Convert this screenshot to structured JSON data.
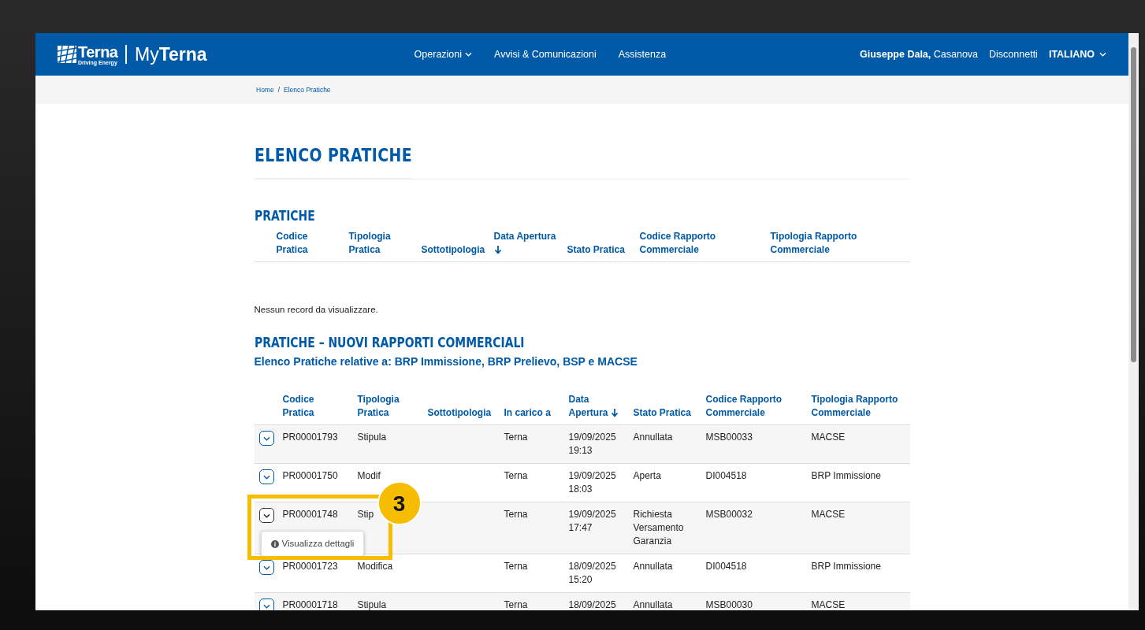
{
  "header": {
    "logo": {
      "brand": "Terna",
      "tagline": "Driving Energy",
      "app_prefix": "My",
      "app_name": "Terna"
    },
    "nav": [
      {
        "label": "Operazioni",
        "dropdown": true
      },
      {
        "label": "Avvisi & Comunicazioni",
        "dropdown": false
      },
      {
        "label": "Assistenza",
        "dropdown": false
      }
    ],
    "user": {
      "name": "Giuseppe Dala,",
      "place": "Casanova"
    },
    "logout": "Disconnetti",
    "language": {
      "label": "ITALIANO",
      "dropdown": true
    }
  },
  "breadcrumb": {
    "items": [
      "Home",
      "Elenco Pratiche"
    ],
    "separator": "/"
  },
  "page_title": "ELENCO PRATICHE",
  "pratiche": {
    "title": "PRATICHE",
    "columns": [
      {
        "label": "Codice\nPratica",
        "sorted": false
      },
      {
        "label": "Tipologia\nPratica",
        "sorted": false
      },
      {
        "label": "Sottotipologia",
        "sorted": false
      },
      {
        "label": "Data Apertura",
        "sorted": true
      },
      {
        "label": "Stato Pratica",
        "sorted": false
      },
      {
        "label": "Codice Rapporto\nCommerciale",
        "sorted": false
      },
      {
        "label": "Tipologia Rapporto\nCommerciale",
        "sorted": false
      }
    ],
    "empty_message": "Nessun record da visualizzare."
  },
  "nuovi": {
    "title": "PRATICHE – NUOVI RAPPORTI COMMERCIALI",
    "subtitle": "Elenco Pratiche relative a: BRP Immissione, BRP Prelievo, BSP e MACSE",
    "columns": [
      {
        "label": "Codice\nPratica",
        "sorted": false
      },
      {
        "label": "Tipologia\nPratica",
        "sorted": false
      },
      {
        "label": "Sottotipologia",
        "sorted": false
      },
      {
        "label": "In carico a",
        "sorted": false
      },
      {
        "label": "Data\nApertura",
        "sorted": true
      },
      {
        "label": "Stato Pratica",
        "sorted": false
      },
      {
        "label": "Codice Rapporto\nCommerciale",
        "sorted": false
      },
      {
        "label": "Tipologia Rapporto\nCommerciale",
        "sorted": false
      }
    ],
    "rows": [
      {
        "cells": [
          "PR00001793",
          "Stipula",
          "",
          "Terna",
          "19/09/2025\n19:13",
          "Annullata",
          "MSB00033",
          "MACSE"
        ],
        "menu_open": false
      },
      {
        "cells": [
          "PR00001750",
          "Modif",
          "",
          "Terna",
          "19/09/2025\n18:03",
          "Aperta",
          "DI004518",
          "BRP Immissione"
        ],
        "menu_open": false
      },
      {
        "cells": [
          "PR00001748",
          "Stip",
          "",
          "Terna",
          "19/09/2025\n17:47",
          "Richiesta\nVersamento\nGaranzia",
          "MSB00032",
          "MACSE"
        ],
        "menu_open": true
      },
      {
        "cells": [
          "PR00001723",
          "Modifica",
          "",
          "Terna",
          "18/09/2025\n15:20",
          "Annullata",
          "DI004518",
          "BRP Immissione"
        ],
        "menu_open": false
      },
      {
        "cells": [
          "PR00001718",
          "Stipula",
          "",
          "Terna",
          "18/09/2025",
          "Annullata",
          "MSB00030",
          "MACSE"
        ],
        "menu_open": false
      }
    ],
    "row_menu": {
      "label": "Visualizza dettagli"
    }
  },
  "annotation": {
    "number": "3"
  }
}
